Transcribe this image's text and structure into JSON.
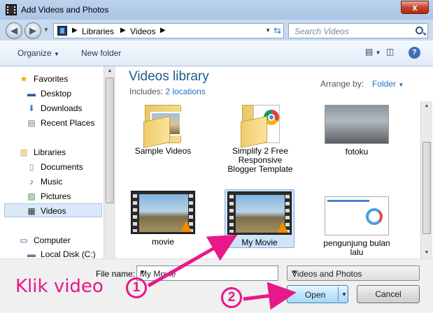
{
  "window": {
    "title": "Add Videos and Photos",
    "close_glyph": "x"
  },
  "address_bar": {
    "crumbs": [
      "Libraries",
      "Videos"
    ],
    "search_placeholder": "Search Videos"
  },
  "toolbar": {
    "organize": "Organize",
    "new_folder": "New folder"
  },
  "nav_pane": {
    "items": [
      {
        "label": "Favorites",
        "icon": "star-icon",
        "glyph": "★",
        "color": "#e8a400"
      },
      {
        "label": "Desktop",
        "icon": "desktop-icon",
        "glyph": "▬",
        "color": "#2d5c9a"
      },
      {
        "label": "Downloads",
        "icon": "downloads-icon",
        "glyph": "⬇",
        "color": "#3a7bd5"
      },
      {
        "label": "Recent Places",
        "icon": "recent-places-icon",
        "glyph": "▤",
        "color": "#6a7a8c"
      },
      {
        "label": "Libraries",
        "icon": "libraries-icon",
        "glyph": "▥",
        "color": "#d5a23c"
      },
      {
        "label": "Documents",
        "icon": "documents-icon",
        "glyph": "▯",
        "color": "#7d8fa4"
      },
      {
        "label": "Music",
        "icon": "music-icon",
        "glyph": "♪",
        "color": "#2e6fb8"
      },
      {
        "label": "Pictures",
        "icon": "pictures-icon",
        "glyph": "▨",
        "color": "#4f8c4a"
      },
      {
        "label": "Videos",
        "icon": "videos-icon",
        "glyph": "▦",
        "color": "#2b2b2b"
      },
      {
        "label": "Computer",
        "icon": "computer-icon",
        "glyph": "▭",
        "color": "#2d5c9a"
      },
      {
        "label": "Local Disk (C:)",
        "icon": "local-disk-icon",
        "glyph": "▬",
        "color": "#6a7a8c"
      }
    ]
  },
  "library": {
    "title": "Videos library",
    "includes_prefix": "Includes:",
    "includes_link": "2 locations",
    "arrange_label": "Arrange by:",
    "arrange_value": "Folder"
  },
  "files": [
    {
      "label": "Sample Videos",
      "kind": "folder"
    },
    {
      "label": "Simplify 2 Free Responsive Blogger Template",
      "kind": "chrome-folder"
    },
    {
      "label": "fotoku",
      "kind": "photo"
    },
    {
      "label": "movie",
      "kind": "video"
    },
    {
      "label": "My Movie",
      "kind": "video"
    },
    {
      "label": "pengunjung bulan lalu",
      "kind": "web"
    }
  ],
  "bottom": {
    "file_name_label": "File name:",
    "file_name_value": "My Movie",
    "type_value": "Videos and Photos",
    "open_label": "Open",
    "cancel_label": "Cancel"
  },
  "annotation": {
    "text": "Klik  video",
    "step1": "1",
    "step2": "2",
    "color": "#e8178a"
  }
}
